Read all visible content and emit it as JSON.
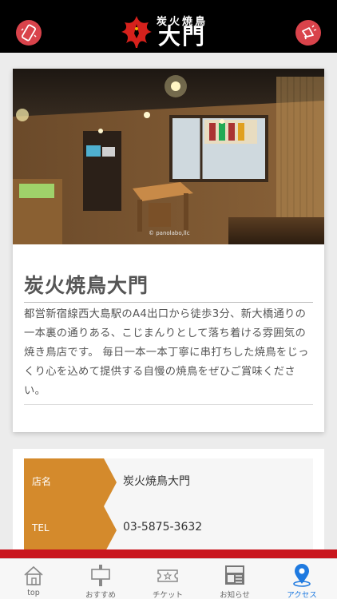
{
  "header": {
    "logo_small": "炭火焼鳥",
    "logo_big": "大門",
    "left_icon": "phone-icon",
    "right_icon": "megaphone-icon",
    "accent": "#d9434b"
  },
  "card": {
    "photo_credit": "© panolabo,llc",
    "shop_name": "炭火焼鳥大門",
    "description": "都営新宿線西大島駅のA4出口から徒歩3分、新大橋通りの一本裏の通りある、こじまんりとして落ち着ける雰囲気の焼き鳥店です。 毎日一本一本丁寧に串打ちした焼鳥をじっくり心を込めて提供する自慢の焼鳥をぜひご賞味ください。"
  },
  "info": {
    "rows": [
      {
        "label": "店名",
        "value": "炭火焼鳥大門"
      },
      {
        "label": "TEL",
        "value": "03-5875-3632"
      }
    ],
    "label_color": "#d48a2c"
  },
  "nav": {
    "tabs": [
      {
        "label": "top",
        "icon": "home-icon"
      },
      {
        "label": "おすすめ",
        "icon": "signboard-icon"
      },
      {
        "label": "チケット",
        "icon": "ticket-icon"
      },
      {
        "label": "お知らせ",
        "icon": "news-icon"
      },
      {
        "label": "アクセス",
        "icon": "map-pin-icon"
      }
    ],
    "active_color": "#1f7ae0",
    "bar_color": "#c9161e"
  }
}
